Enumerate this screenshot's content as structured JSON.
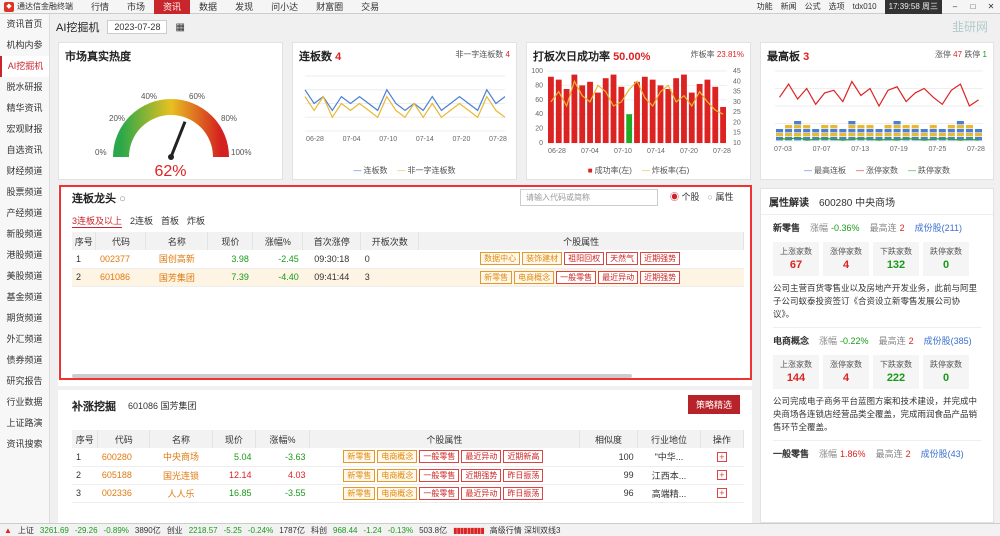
{
  "app": {
    "title": "通达信金融终端",
    "menu": [
      "行情",
      "市场",
      "资讯",
      "数据",
      "发现",
      "问小达",
      "财富圈",
      "交易"
    ],
    "active_menu": "资讯",
    "right_items": [
      "功能",
      "新闻",
      "公式",
      "选项"
    ],
    "account": "tdx010",
    "clock": "17:39:58 周三"
  },
  "sidebar": [
    "资讯首页",
    "机构内参",
    "AI挖掘机",
    "脱水研报",
    "精华资讯",
    "宏观财报",
    "自选资讯",
    "财经频道",
    "股票频道",
    "产经频道",
    "新股频道",
    "港股频道",
    "美股频道",
    "基金频道",
    "期货频道",
    "外汇频道",
    "债券频道",
    "研究报告",
    "行业数据",
    "上证路演",
    "资讯搜索"
  ],
  "sidebar_active": "AI挖掘机",
  "header": {
    "title": "AI挖掘机",
    "date": "2023-07-28",
    "watermark": "韭研网"
  },
  "heat": {
    "title": "市场真实热度",
    "value": "62%",
    "pct": 0.62,
    "ticks": [
      "0%",
      "20%",
      "40%",
      "60%",
      "80%",
      "100%"
    ]
  },
  "lianban": {
    "title": "连板数",
    "count": "4",
    "sub_label": "非一字连板数",
    "sub_value": "4",
    "legend": [
      "连板数",
      "非一字连板数"
    ],
    "xlabels": [
      "06-28",
      "07-04",
      "07-10",
      "07-14",
      "07-20",
      "07-28"
    ],
    "chart_data": {
      "type": "line",
      "series": [
        {
          "name": "连板数",
          "values": [
            8,
            6,
            7,
            5,
            7,
            6,
            7,
            6,
            5,
            8,
            6,
            5,
            6,
            5,
            7,
            5,
            6,
            7,
            6,
            5,
            8,
            6,
            7
          ]
        },
        {
          "name": "非一字连板数",
          "values": [
            7,
            5,
            7,
            4,
            6,
            5,
            6,
            5,
            4,
            7,
            5,
            4,
            6,
            4,
            6,
            4,
            5,
            6,
            5,
            4,
            7,
            5,
            4
          ]
        }
      ]
    }
  },
  "daban": {
    "title": "打板次日成功率",
    "rate": "50.00%",
    "sub_label": "炸板率",
    "sub_value": "23.81%",
    "legend": [
      "成功率(左)",
      "炸板率(右)"
    ],
    "xlabels": [
      "06-28",
      "07-04",
      "07-10",
      "07-14",
      "07-20",
      "07-28"
    ],
    "yleft": [
      "100",
      "80",
      "60",
      "40",
      "20",
      "0"
    ],
    "yright": [
      "45",
      "40",
      "35",
      "30",
      "25",
      "20",
      "15",
      "10"
    ],
    "chart_data": {
      "type": "bar",
      "values": [
        92,
        88,
        75,
        95,
        80,
        85,
        70,
        90,
        95,
        78,
        40,
        85,
        92,
        88,
        80,
        75,
        90,
        95,
        70,
        82,
        88,
        78,
        50
      ],
      "line": [
        30,
        35,
        28,
        40,
        33,
        30,
        38,
        35,
        28,
        30,
        36,
        40,
        32,
        28,
        35,
        38,
        30,
        33,
        28,
        35,
        30,
        26,
        24
      ]
    }
  },
  "maxban": {
    "title": "最高板",
    "count": "3",
    "rise_label": "涨停",
    "rise": "47",
    "stop_label": "跌停",
    "stop": "1",
    "legend": [
      "最高连板",
      "涨停家数",
      "跌停家数"
    ],
    "xlabels": [
      "07-03",
      "07-07",
      "07-13",
      "07-19",
      "07-25",
      "07-28"
    ],
    "chart_data": {
      "type": "line",
      "series": [
        {
          "name": "最高连板",
          "values": [
            3,
            4,
            5,
            4,
            3,
            4,
            4,
            3,
            5,
            4,
            4,
            3,
            4,
            5,
            4,
            4,
            3,
            4,
            3,
            4,
            5,
            4,
            3
          ]
        },
        {
          "name": "涨停家数",
          "values": [
            50,
            65,
            48,
            60,
            42,
            55,
            58,
            45,
            68,
            52,
            60,
            40,
            58,
            62,
            45,
            55,
            60,
            50,
            42,
            58,
            65,
            40,
            47
          ]
        },
        {
          "name": "跌停家数",
          "values": [
            3,
            2,
            4,
            1,
            2,
            3,
            2,
            1,
            2,
            3,
            2,
            1,
            2,
            1,
            3,
            2,
            1,
            2,
            3,
            2,
            1,
            2,
            1
          ]
        }
      ]
    }
  },
  "lianban_leader": {
    "title": "连板龙头",
    "search_placeholder": "请输入代码或简称",
    "radio": [
      "个股",
      "属性"
    ],
    "tabs": [
      "3连板及以上",
      "2连板",
      "首板",
      "炸板"
    ],
    "columns": [
      "序号",
      "代码",
      "名称",
      "现价",
      "涨幅%",
      "首次涨停",
      "开板次数",
      "个股属性"
    ],
    "rows": [
      {
        "idx": "1",
        "code": "002377",
        "name": "国创高新",
        "price": "3.98",
        "chg": "-2.45",
        "first": "09:30:18",
        "open": "0",
        "tags": [
          "数据中心",
          "装饰建材"
        ],
        "rtags": [
          "祖阳回权",
          "天然气",
          "近期强势"
        ]
      },
      {
        "idx": "2",
        "code": "601086",
        "name": "国芳集团",
        "price": "7.39",
        "chg": "-4.40",
        "first": "09:41:44",
        "open": "3",
        "tags": [
          "新零售",
          "电商概念"
        ],
        "rtags": [
          "一般零售",
          "最近异动",
          "近期强势"
        ]
      }
    ]
  },
  "buzhang": {
    "title": "补涨挖掘",
    "stock": "601086 国芳集团",
    "button": "策略精选",
    "columns": [
      "序号",
      "代码",
      "名称",
      "现价",
      "涨幅%",
      "个股属性",
      "相似度",
      "行业地位",
      "操作"
    ],
    "rows": [
      {
        "idx": "1",
        "code": "600280",
        "name": "中央商场",
        "price": "5.04",
        "chg": "-3.63",
        "tags": [
          "新零售",
          "电商概念"
        ],
        "rtags": [
          "一般零售",
          "最近异动",
          "近期新高"
        ],
        "sim": "100",
        "ind": "\"中华..."
      },
      {
        "idx": "2",
        "code": "605188",
        "name": "国光连锁",
        "price": "12.14",
        "chg": "4.03",
        "tags": [
          "新零售",
          "电商概念"
        ],
        "rtags": [
          "一般零售",
          "近期强势",
          "昨日振荡"
        ],
        "sim": "99",
        "ind": "江西本..."
      },
      {
        "idx": "3",
        "code": "002336",
        "name": "人人乐",
        "price": "16.85",
        "chg": "-3.55",
        "tags": [
          "新零售",
          "电商概念"
        ],
        "rtags": [
          "一般零售",
          "最近异动",
          "昨日振荡"
        ],
        "sim": "96",
        "ind": "高端精..."
      }
    ]
  },
  "attr": {
    "title": "属性解读",
    "stock": "600280 中央商场",
    "concepts": [
      {
        "name": "新零售",
        "chg_label": "涨幅",
        "chg": "-0.36%",
        "high_label": "最高连",
        "high": "2",
        "link": "成份股",
        "count": "(211)",
        "stats": [
          {
            "k": "上涨家数",
            "v": "67"
          },
          {
            "k": "涨停家数",
            "v": "4"
          },
          {
            "k": "下跌家数",
            "v": "132"
          },
          {
            "k": "跌停家数",
            "v": "0"
          }
        ],
        "desc": "公司主营百货零售业以及房地产开发业务，此前与阿里子公司蚁泰投资签订《合资设立新零售发展公司协议》。"
      },
      {
        "name": "电商概念",
        "chg_label": "涨幅",
        "chg": "-0.22%",
        "high_label": "最高连",
        "high": "2",
        "link": "成份股",
        "count": "(385)",
        "stats": [
          {
            "k": "上涨家数",
            "v": "144"
          },
          {
            "k": "涨停家数",
            "v": "4"
          },
          {
            "k": "下跌家数",
            "v": "222"
          },
          {
            "k": "跌停家数",
            "v": "0"
          }
        ],
        "desc": "公司完成电子商务平台蓝图方案和技术建设，并完成中央商场各连锁店经营品类全覆盖，完成雨润食品产品销售环节全覆盖。"
      },
      {
        "name": "一般零售",
        "chg_label": "涨幅",
        "chg": "1.86%",
        "high_label": "最高连",
        "high": "2",
        "link": "成份股",
        "count": "(43)"
      }
    ]
  },
  "status": {
    "sh_label": "上证",
    "sh": "3261.69",
    "sh_chg": "-29.26",
    "sh_pct": "-0.89%",
    "sh_amt": "3890亿",
    "cy_label": "创业",
    "cy": "2218.57",
    "cy_chg": "-5.25",
    "cy_pct": "-0.24%",
    "cy_amt": "1787亿",
    "kc_label": "科创",
    "kc": "968.44",
    "kc_chg": "-1.24",
    "kc_pct": "-0.13%",
    "kc_amt": "503.8亿",
    "tail": "高级行情 深圳双线3"
  }
}
